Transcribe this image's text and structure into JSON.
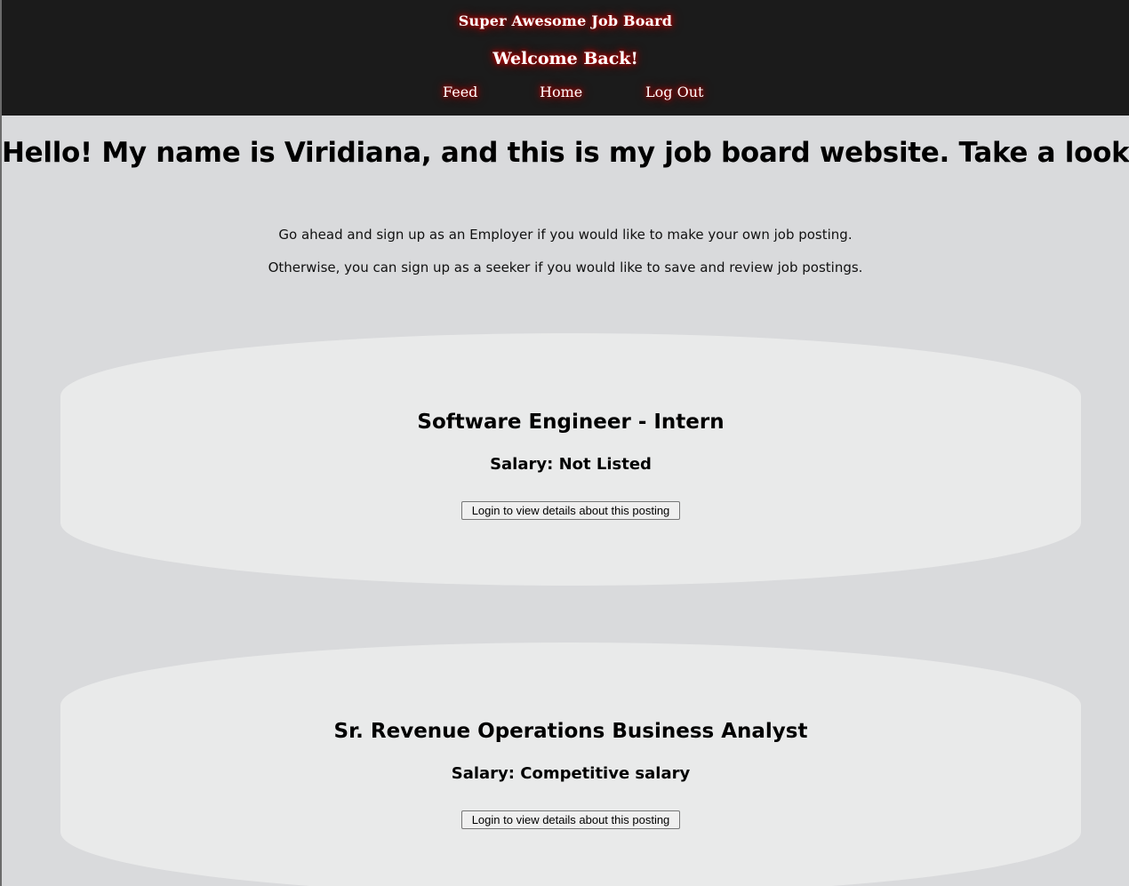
{
  "header": {
    "site_title": "Super Awesome Job Board",
    "welcome": "Welcome Back!",
    "nav": [
      {
        "label": "Feed"
      },
      {
        "label": "Home"
      },
      {
        "label": "Log Out"
      }
    ],
    "background_color": "#1b1b1b",
    "glow_color": "#b00000"
  },
  "main": {
    "heading": "Hello! My name is Viridiana, and this is my job board website. Take a look around!",
    "intro_lines": [
      "Go ahead and sign up as an Employer if you would like to make your own job posting.",
      "Otherwise, you can sign up as a seeker if you would like to save and review job postings."
    ],
    "postings": [
      {
        "title": "Software Engineer - Intern",
        "salary": "Salary: Not Listed",
        "button_label": "Login to view details about this posting"
      },
      {
        "title": "Sr. Revenue Operations Business Analyst",
        "salary": "Salary: Competitive salary",
        "button_label": "Login to view details about this posting"
      }
    ]
  }
}
